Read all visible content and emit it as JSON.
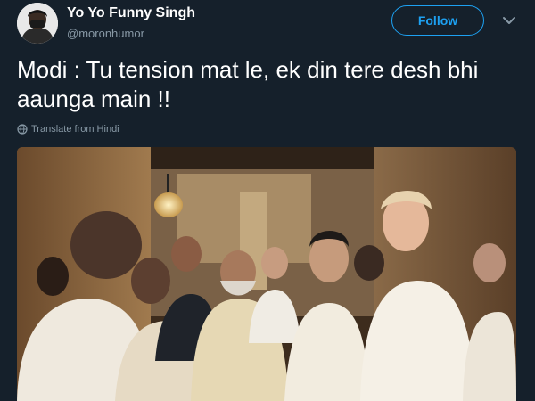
{
  "tweet": {
    "display_name": "Yo Yo Funny Singh",
    "handle": "@moronhumor",
    "follow_label": "Follow",
    "text": "Modi : Tu tension mat le, ek din tere desh bhi aaunga main !!",
    "translate_label": "Translate from Hindi",
    "photo_icon": "group-photo"
  },
  "icons": {
    "avatar": "masked-person-avatar",
    "menu": "chevron-down-icon",
    "translate": "globe-icon"
  },
  "colors": {
    "background": "#15202b",
    "accent": "#1da1f2",
    "secondary_text": "#8899a6"
  }
}
